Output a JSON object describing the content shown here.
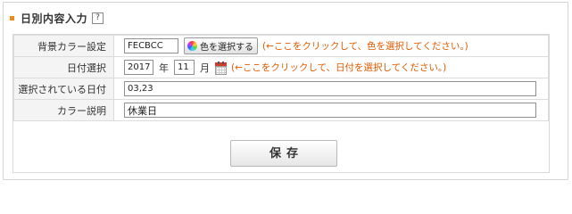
{
  "header": {
    "title": "日別内容入力",
    "help_label": "?"
  },
  "form": {
    "bg_color": {
      "label": "背景カラー設定",
      "value": "FECBCC",
      "button_label": "色を選択する",
      "hint": "(←ここをクリックして、色を選択してください。)"
    },
    "date": {
      "label": "日付選択",
      "year_value": "2017",
      "year_unit": "年",
      "month_value": "11",
      "month_unit": "月",
      "hint": "(←ここをクリックして、日付を選択してください。)"
    },
    "selected_dates": {
      "label": "選択されている日付",
      "value": "03,23"
    },
    "color_description": {
      "label": "カラー説明",
      "value": "休業日"
    }
  },
  "actions": {
    "save_label": "保存"
  },
  "colors": {
    "accent": "#f08a1c",
    "hint_text": "#e05a00"
  }
}
